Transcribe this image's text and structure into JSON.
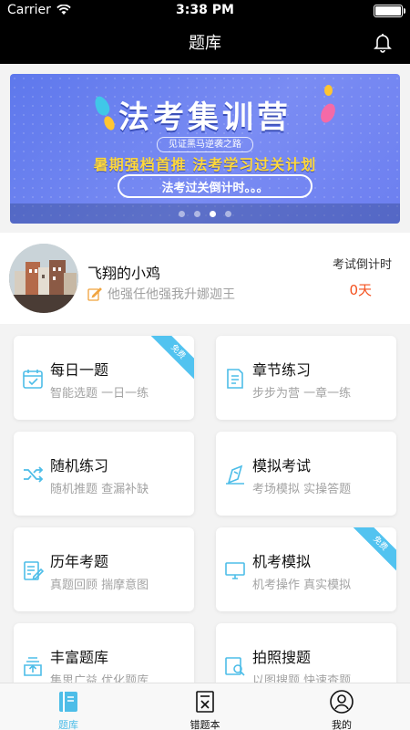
{
  "status": {
    "carrier": "Carrier",
    "time": "3:38 PM"
  },
  "nav": {
    "title": "题库"
  },
  "banner": {
    "title": "法考集训营",
    "subtitle": "见证黑马逆袭之路",
    "slogan": "暑期强档首推  法考学习过关计划",
    "countdown_text": "法考过关倒计时。。。",
    "pages": 4,
    "active_page": 3
  },
  "profile": {
    "username": "飞翔的小鸡",
    "motto": "他强任他强我升娜迦王",
    "countdown_label": "考试倒计时",
    "countdown_value": "0天"
  },
  "cards": [
    {
      "title": "每日一题",
      "subtitle": "智能选题 一日一练",
      "badge": "免费",
      "icon": "calendar-check-icon"
    },
    {
      "title": "章节练习",
      "subtitle": "步步为营 一章一练",
      "badge": "",
      "icon": "document-list-icon"
    },
    {
      "title": "随机练习",
      "subtitle": "随机推题 查漏补缺",
      "badge": "",
      "icon": "shuffle-icon"
    },
    {
      "title": "模拟考试",
      "subtitle": "考场模拟 实操答题",
      "badge": "",
      "icon": "exam-flag-icon"
    },
    {
      "title": "历年考题",
      "subtitle": "真题回顾 揣摩意图",
      "badge": "",
      "icon": "paper-edit-icon"
    },
    {
      "title": "机考模拟",
      "subtitle": "机考操作 真实模拟",
      "badge": "免费",
      "icon": "monitor-icon"
    },
    {
      "title": "丰富题库",
      "subtitle": "集思广益 优化题库",
      "badge": "",
      "icon": "upload-box-icon"
    },
    {
      "title": "拍照搜题",
      "subtitle": "以图搜题 快速查题",
      "badge": "",
      "icon": "photo-search-icon"
    }
  ],
  "tabs": [
    {
      "label": "题库",
      "icon": "question-bank-icon",
      "active": true
    },
    {
      "label": "错题本",
      "icon": "wrong-book-icon",
      "active": false
    },
    {
      "label": "我的",
      "icon": "user-icon",
      "active": false
    }
  ],
  "colors": {
    "accent": "#4dbde8",
    "countdown": "#f4511e",
    "badge": "#52c3f0",
    "banner": "#6c7ff0"
  }
}
